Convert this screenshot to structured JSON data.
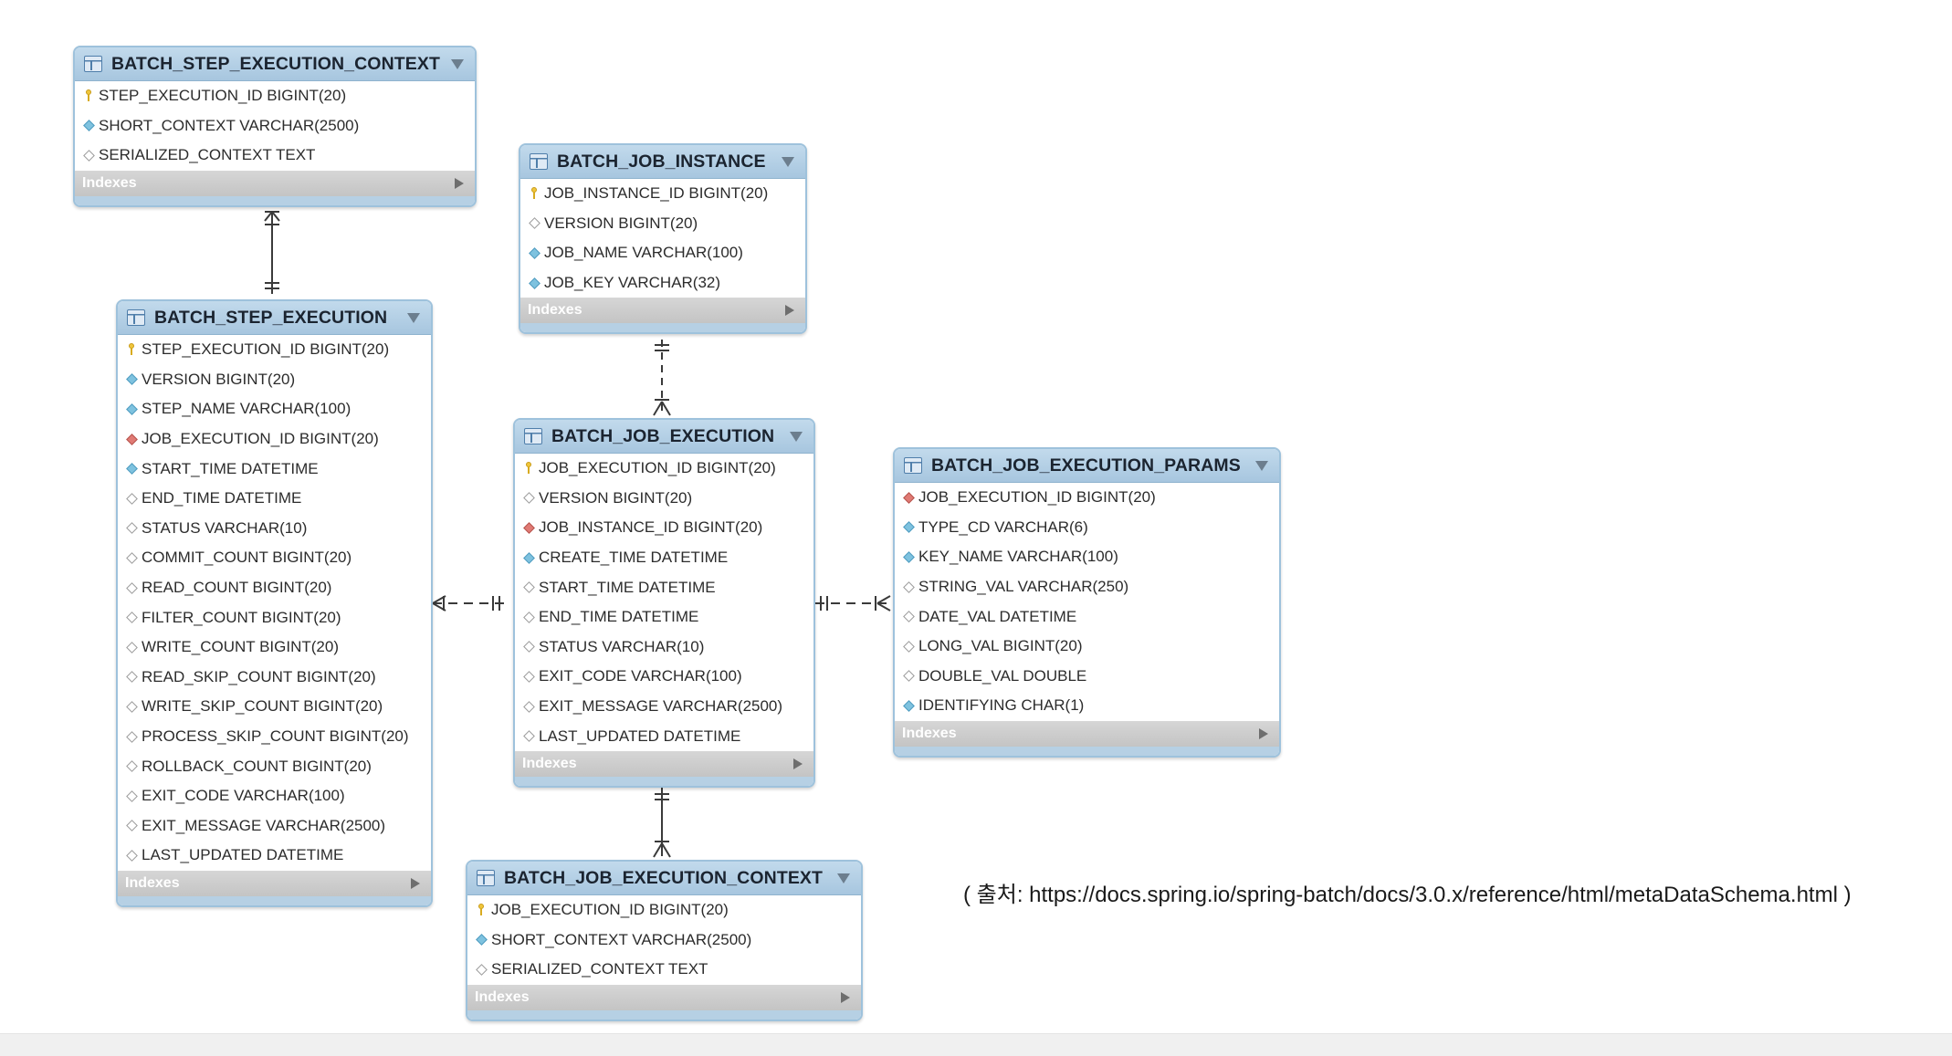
{
  "diagram": {
    "tables": [
      {
        "id": "t_step_ctx",
        "name": "BATCH_STEP_EXECUTION_CONTEXT",
        "indexes_label": "Indexes",
        "columns": [
          {
            "text": "STEP_EXECUTION_ID BIGINT(20)",
            "marker": "pk"
          },
          {
            "text": "SHORT_CONTEXT VARCHAR(2500)",
            "marker": "notnull"
          },
          {
            "text": "SERIALIZED_CONTEXT TEXT",
            "marker": "nullable"
          }
        ]
      },
      {
        "id": "t_job_instance",
        "name": "BATCH_JOB_INSTANCE",
        "indexes_label": "Indexes",
        "columns": [
          {
            "text": "JOB_INSTANCE_ID BIGINT(20)",
            "marker": "pk"
          },
          {
            "text": "VERSION BIGINT(20)",
            "marker": "nullable"
          },
          {
            "text": "JOB_NAME VARCHAR(100)",
            "marker": "notnull"
          },
          {
            "text": "JOB_KEY VARCHAR(32)",
            "marker": "notnull"
          }
        ]
      },
      {
        "id": "t_step_exec",
        "name": "BATCH_STEP_EXECUTION",
        "indexes_label": "Indexes",
        "columns": [
          {
            "text": "STEP_EXECUTION_ID BIGINT(20)",
            "marker": "pk"
          },
          {
            "text": "VERSION BIGINT(20)",
            "marker": "notnull"
          },
          {
            "text": "STEP_NAME VARCHAR(100)",
            "marker": "notnull"
          },
          {
            "text": "JOB_EXECUTION_ID BIGINT(20)",
            "marker": "fk"
          },
          {
            "text": "START_TIME DATETIME",
            "marker": "notnull"
          },
          {
            "text": "END_TIME DATETIME",
            "marker": "nullable"
          },
          {
            "text": "STATUS VARCHAR(10)",
            "marker": "nullable"
          },
          {
            "text": "COMMIT_COUNT BIGINT(20)",
            "marker": "nullable"
          },
          {
            "text": "READ_COUNT BIGINT(20)",
            "marker": "nullable"
          },
          {
            "text": "FILTER_COUNT BIGINT(20)",
            "marker": "nullable"
          },
          {
            "text": "WRITE_COUNT BIGINT(20)",
            "marker": "nullable"
          },
          {
            "text": "READ_SKIP_COUNT BIGINT(20)",
            "marker": "nullable"
          },
          {
            "text": "WRITE_SKIP_COUNT BIGINT(20)",
            "marker": "nullable"
          },
          {
            "text": "PROCESS_SKIP_COUNT BIGINT(20)",
            "marker": "nullable"
          },
          {
            "text": "ROLLBACK_COUNT BIGINT(20)",
            "marker": "nullable"
          },
          {
            "text": "EXIT_CODE VARCHAR(100)",
            "marker": "nullable"
          },
          {
            "text": "EXIT_MESSAGE VARCHAR(2500)",
            "marker": "nullable"
          },
          {
            "text": "LAST_UPDATED DATETIME",
            "marker": "nullable"
          }
        ]
      },
      {
        "id": "t_job_exec",
        "name": "BATCH_JOB_EXECUTION",
        "indexes_label": "Indexes",
        "columns": [
          {
            "text": "JOB_EXECUTION_ID BIGINT(20)",
            "marker": "pk"
          },
          {
            "text": "VERSION BIGINT(20)",
            "marker": "nullable"
          },
          {
            "text": "JOB_INSTANCE_ID BIGINT(20)",
            "marker": "fk"
          },
          {
            "text": "CREATE_TIME DATETIME",
            "marker": "notnull"
          },
          {
            "text": "START_TIME DATETIME",
            "marker": "nullable"
          },
          {
            "text": "END_TIME DATETIME",
            "marker": "nullable"
          },
          {
            "text": "STATUS VARCHAR(10)",
            "marker": "nullable"
          },
          {
            "text": "EXIT_CODE VARCHAR(100)",
            "marker": "nullable"
          },
          {
            "text": "EXIT_MESSAGE VARCHAR(2500)",
            "marker": "nullable"
          },
          {
            "text": "LAST_UPDATED DATETIME",
            "marker": "nullable"
          }
        ]
      },
      {
        "id": "t_job_params",
        "name": "BATCH_JOB_EXECUTION_PARAMS",
        "indexes_label": "Indexes",
        "columns": [
          {
            "text": "JOB_EXECUTION_ID BIGINT(20)",
            "marker": "fk"
          },
          {
            "text": "TYPE_CD VARCHAR(6)",
            "marker": "notnull"
          },
          {
            "text": "KEY_NAME VARCHAR(100)",
            "marker": "notnull"
          },
          {
            "text": "STRING_VAL VARCHAR(250)",
            "marker": "nullable"
          },
          {
            "text": "DATE_VAL DATETIME",
            "marker": "nullable"
          },
          {
            "text": "LONG_VAL BIGINT(20)",
            "marker": "nullable"
          },
          {
            "text": "DOUBLE_VAL DOUBLE",
            "marker": "nullable"
          },
          {
            "text": "IDENTIFYING CHAR(1)",
            "marker": "notnull"
          }
        ]
      },
      {
        "id": "t_job_ctx",
        "name": "BATCH_JOB_EXECUTION_CONTEXT",
        "indexes_label": "Indexes",
        "columns": [
          {
            "text": "JOB_EXECUTION_ID BIGINT(20)",
            "marker": "pk"
          },
          {
            "text": "SHORT_CONTEXT VARCHAR(2500)",
            "marker": "notnull"
          },
          {
            "text": "SERIALIZED_CONTEXT TEXT",
            "marker": "nullable"
          }
        ]
      }
    ]
  },
  "source_note": "( 출처:  https://docs.spring.io/spring-batch/docs/3.0.x/reference/html/metaDataSchema.html   )"
}
